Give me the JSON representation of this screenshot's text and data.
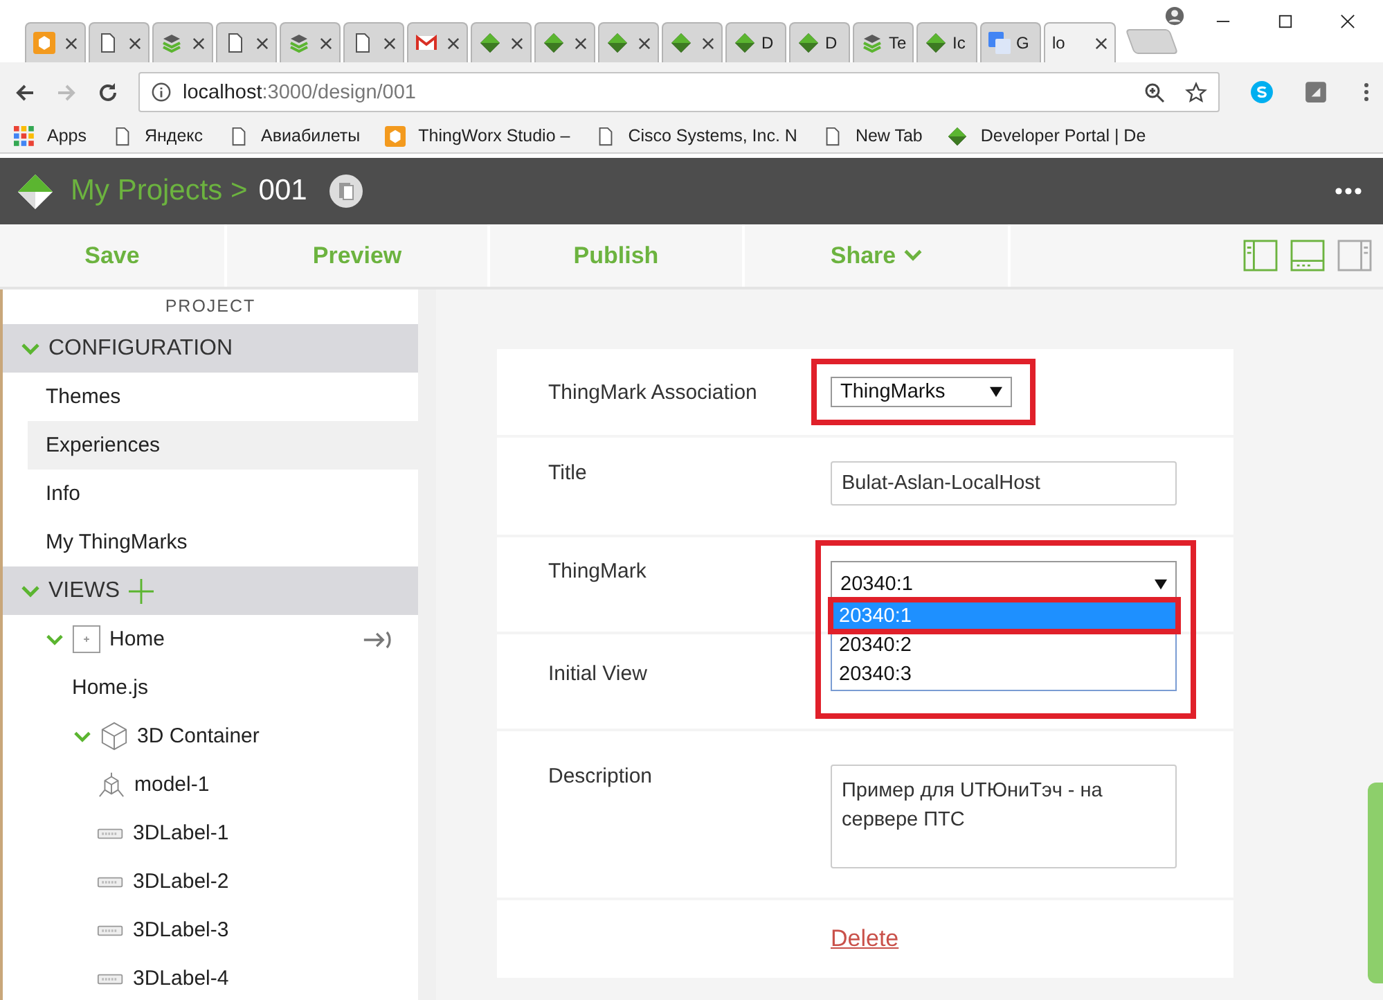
{
  "browser": {
    "tabs": [
      {
        "kind": "studio-orange",
        "selected": false
      },
      {
        "kind": "page",
        "selected": false
      },
      {
        "kind": "stack",
        "selected": false
      },
      {
        "kind": "page",
        "selected": false
      },
      {
        "kind": "stack",
        "selected": false
      },
      {
        "kind": "page",
        "selected": false
      },
      {
        "kind": "mail",
        "selected": false
      },
      {
        "kind": "diamond",
        "selected": false
      },
      {
        "kind": "diamond",
        "selected": false
      },
      {
        "kind": "diamond",
        "selected": false
      },
      {
        "kind": "diamond",
        "selected": false
      },
      {
        "kind": "diamond",
        "title": "D",
        "selected": false
      },
      {
        "kind": "diamond",
        "title": "D",
        "selected": false
      },
      {
        "kind": "stack",
        "title": "Te",
        "selected": false
      },
      {
        "kind": "diamond",
        "title": "Ic",
        "selected": false
      },
      {
        "kind": "translate",
        "title": "G",
        "selected": false
      },
      {
        "title": "lo",
        "selected": true
      }
    ],
    "address": {
      "host": "localhost",
      "path": ":3000/design/001"
    },
    "bookmarks": [
      {
        "kind": "apps",
        "label": "Apps"
      },
      {
        "kind": "page",
        "label": "Яндекс"
      },
      {
        "kind": "page",
        "label": "Авиабилеты"
      },
      {
        "kind": "studio-orange",
        "label": "ThingWorx Studio –"
      },
      {
        "kind": "page",
        "label": "Cisco Systems, Inc. N"
      },
      {
        "kind": "page",
        "label": "New Tab"
      },
      {
        "kind": "diamond",
        "label": "Developer Portal | De"
      }
    ]
  },
  "header": {
    "breadcrumb": "My Projects >",
    "project": "001"
  },
  "toolbar": {
    "buttons": [
      {
        "label": "Save",
        "dropdown": false
      },
      {
        "label": "Preview",
        "dropdown": false
      },
      {
        "label": "Publish",
        "dropdown": false
      },
      {
        "label": "Share",
        "dropdown": true
      }
    ],
    "layouts": [
      {
        "kind": "left",
        "on": true
      },
      {
        "kind": "bottom",
        "on": true
      },
      {
        "kind": "right",
        "on": false
      }
    ]
  },
  "sidebar": {
    "heading": "PROJECT",
    "sections": [
      {
        "label": "CONFIGURATION",
        "expanded": true,
        "addable": false,
        "items": [
          {
            "label": "Themes",
            "selected": false
          },
          {
            "label": "Experiences",
            "selected": true
          },
          {
            "label": "Info",
            "selected": false
          },
          {
            "label": "My ThingMarks",
            "selected": false
          }
        ]
      },
      {
        "label": "VIEWS",
        "expanded": true,
        "addable": true,
        "items": [
          {
            "label": "Home",
            "kind": "view",
            "selected": false,
            "expanded": true,
            "children": [
              {
                "label": "Home.js",
                "selected": false
              },
              {
                "label": "3D Container",
                "kind": "cube",
                "selected": false,
                "expanded": true,
                "children": [
                  {
                    "label": "model-1",
                    "kind": "model",
                    "selected": false
                  },
                  {
                    "label": "3DLabel-1",
                    "kind": "label",
                    "selected": false
                  },
                  {
                    "label": "3DLabel-2",
                    "kind": "label",
                    "selected": false
                  },
                  {
                    "label": "3DLabel-3",
                    "kind": "label",
                    "selected": false
                  },
                  {
                    "label": "3DLabel-4",
                    "kind": "label",
                    "selected": false
                  }
                ]
              }
            ]
          }
        ]
      }
    ]
  },
  "form": {
    "rows": [
      {
        "label": "ThingMark Association",
        "kind": "select",
        "value": "ThingMarks",
        "highlighted": true
      },
      {
        "label": "Title",
        "kind": "text",
        "value": "Bulat-Aslan-LocalHost",
        "highlighted": false
      },
      {
        "label": "ThingMark",
        "kind": "select-open",
        "value": "20340:1",
        "highlighted": true,
        "options": [
          {
            "label": "20340:1",
            "selected": true
          },
          {
            "label": "20340:2",
            "selected": false
          },
          {
            "label": "20340:3",
            "selected": false
          }
        ]
      },
      {
        "label": "Initial View",
        "kind": "hidden",
        "highlighted": false
      },
      {
        "label": "Description",
        "kind": "textarea",
        "value": "Пример для UTЮниТэч - на сервере ПТС",
        "highlighted": false
      }
    ],
    "delete_link": "Delete"
  }
}
